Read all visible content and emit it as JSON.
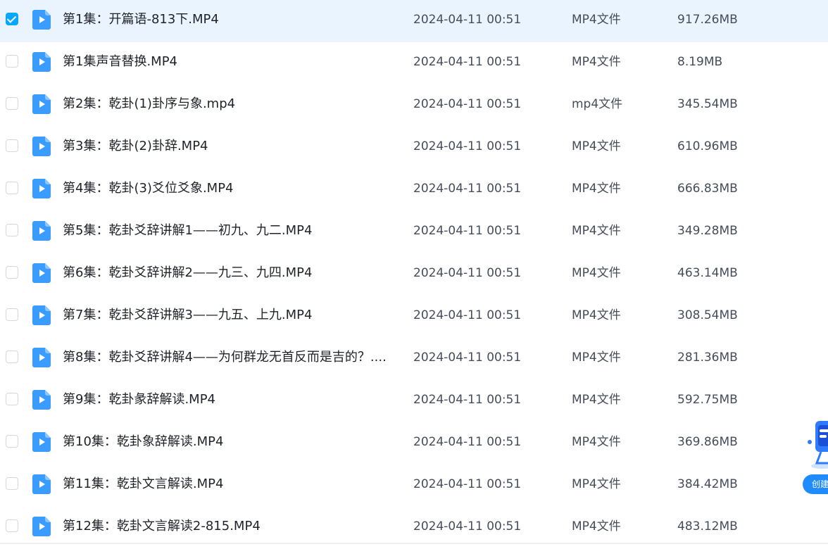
{
  "files": [
    {
      "name": "第1集：开篇语-813下.MP4",
      "date": "2024-04-11 00:51",
      "type": "MP4文件",
      "size": "917.26MB",
      "selected": true
    },
    {
      "name": "第1集声音替换.MP4",
      "date": "2024-04-11 00:51",
      "type": "MP4文件",
      "size": "8.19MB",
      "selected": false
    },
    {
      "name": "第2集：乾卦(1)卦序与象.mp4",
      "date": "2024-04-11 00:51",
      "type": "mp4文件",
      "size": "345.54MB",
      "selected": false
    },
    {
      "name": "第3集：乾卦(2)卦辞.MP4",
      "date": "2024-04-11 00:51",
      "type": "MP4文件",
      "size": "610.96MB",
      "selected": false
    },
    {
      "name": "第4集：乾卦(3)爻位爻象.MP4",
      "date": "2024-04-11 00:51",
      "type": "MP4文件",
      "size": "666.83MB",
      "selected": false
    },
    {
      "name": "第5集：乾卦爻辞讲解1——初九、九二.MP4",
      "date": "2024-04-11 00:51",
      "type": "MP4文件",
      "size": "349.28MB",
      "selected": false
    },
    {
      "name": "第6集：乾卦爻辞讲解2——九三、九四.MP4",
      "date": "2024-04-11 00:51",
      "type": "MP4文件",
      "size": "463.14MB",
      "selected": false
    },
    {
      "name": "第7集：乾卦爻辞讲解3——九五、上九.MP4",
      "date": "2024-04-11 00:51",
      "type": "MP4文件",
      "size": "308.54MB",
      "selected": false
    },
    {
      "name": "第8集：乾卦爻辞讲解4——为何群龙无首反而是吉的？....",
      "date": "2024-04-11 00:51",
      "type": "MP4文件",
      "size": "281.36MB",
      "selected": false
    },
    {
      "name": "第9集：乾卦彖辞解读.MP4",
      "date": "2024-04-11 00:51",
      "type": "MP4文件",
      "size": "592.75MB",
      "selected": false
    },
    {
      "name": "第10集：乾卦象辞解读.MP4",
      "date": "2024-04-11 00:51",
      "type": "MP4文件",
      "size": "369.86MB",
      "selected": false
    },
    {
      "name": "第11集：乾卦文言解读.MP4",
      "date": "2024-04-11 00:51",
      "type": "MP4文件",
      "size": "384.42MB",
      "selected": false
    },
    {
      "name": "第12集：乾卦文言解读2-815.MP4",
      "date": "2024-04-11 00:51",
      "type": "MP4文件",
      "size": "483.12MB",
      "selected": false
    }
  ],
  "icons": {
    "file": "video-file-icon",
    "checked": "check-icon"
  },
  "colors": {
    "accent": "#06a7ff",
    "selected_row": "#eaf4ff",
    "video_icon": "#3b9cff"
  },
  "float_widget": {
    "label": "创建"
  }
}
